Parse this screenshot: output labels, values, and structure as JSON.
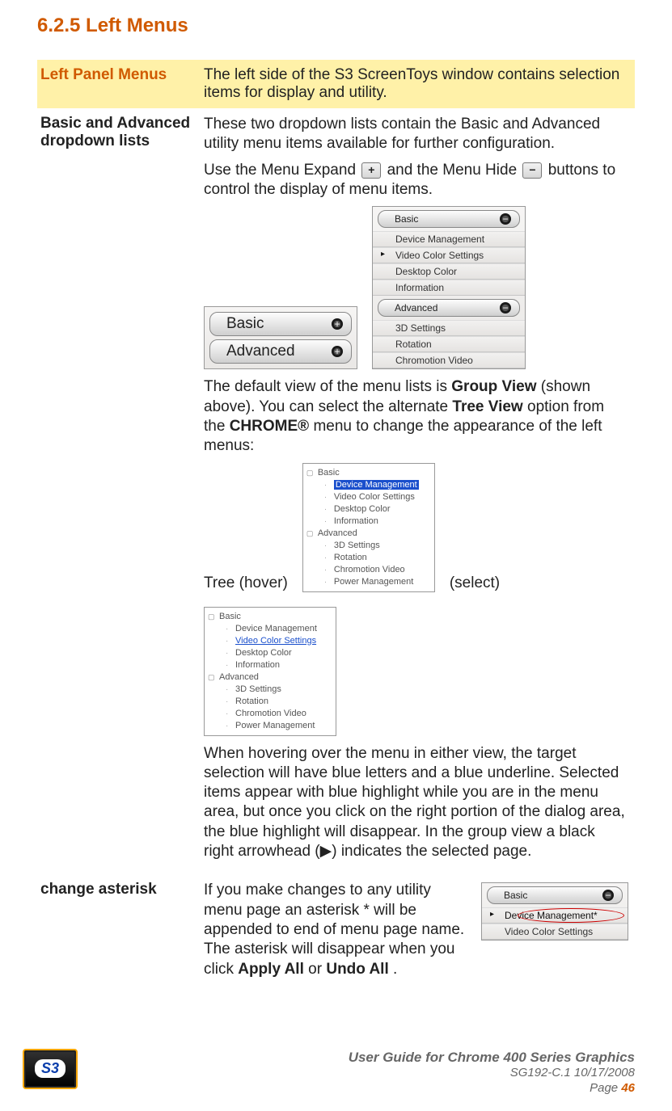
{
  "heading": "6.2.5 Left Menus",
  "rows": {
    "r1": {
      "label": "Left Panel Menus",
      "text": "The left side of the S3 ScreenToys window contains selection items for display and utility."
    },
    "r2": {
      "label": "Basic and Advanced dropdown lists",
      "p1_a": "These two dropdown lists contain the Basic and Advanced utility menu items available for further configuration.",
      "p1_b_pre": "Use the Menu Expand ",
      "p1_b_mid": "and the Menu Hide ",
      "p1_b_post": " buttons to control the display of menu items.",
      "p2_a": "The default view of the menu lists is ",
      "p2_bold1": "Group View",
      "p2_b": " (shown above). You can select the alternate ",
      "p2_bold2": "Tree View",
      "p2_c": " option from the ",
      "p2_bold3": "CHROME®",
      "p2_d": " menu to change the appearance of the left menus:",
      "tree_label_hover": "Tree (hover)",
      "tree_label_select": "(select)",
      "p3": "When hovering over the menu in either view, the target selection will have blue letters and a blue underline. Selected items appear with blue highlight while you are in the menu area, but once you click on the right portion of the dialog area, the blue highlight will disappear. In the group view a black right arrowhead (▶) indicates the selected page."
    },
    "r3": {
      "label": "change asterisk",
      "p_a": "If you make changes to any utility menu page an asterisk * will be appended to end of menu page name. The asterisk will disappear when you click ",
      "p_bold1": "Apply All",
      "p_or": " or ",
      "p_bold2": "Undo All",
      "p_end": "."
    }
  },
  "icons": {
    "plus": "+",
    "minus": "−"
  },
  "group_collapsed": {
    "basic": "Basic",
    "advanced": "Advanced"
  },
  "group_expanded": {
    "basic": {
      "title": "Basic",
      "items": [
        "Device Management",
        "Video Color Settings",
        "Desktop Color",
        "Information"
      ]
    },
    "advanced": {
      "title": "Advanced",
      "items": [
        "3D Settings",
        "Rotation",
        "Chromotion Video"
      ]
    }
  },
  "tree_hover": {
    "basic": "Basic",
    "basic_items": [
      "Device Management",
      "Video Color Settings",
      "Desktop Color",
      "Information"
    ],
    "advanced": "Advanced",
    "adv_items": [
      "3D Settings",
      "Rotation",
      "Chromotion Video",
      "Power Management"
    ]
  },
  "tree_select": {
    "basic": "Basic",
    "basic_items": [
      "Device Management",
      "Video Color Settings",
      "Desktop Color",
      "Information"
    ],
    "advanced": "Advanced",
    "adv_items": [
      "3D Settings",
      "Rotation",
      "Chromotion Video",
      "Power Management"
    ]
  },
  "asterisk_panel": {
    "title": "Basic",
    "items": [
      "Device Management*",
      "Video Color Settings"
    ]
  },
  "footer": {
    "line1": "User Guide for Chrome 400 Series Graphics",
    "line2": "SG192-C.1   10/17/2008",
    "page_label": "Page ",
    "page_num": "46",
    "logo": "S3"
  }
}
